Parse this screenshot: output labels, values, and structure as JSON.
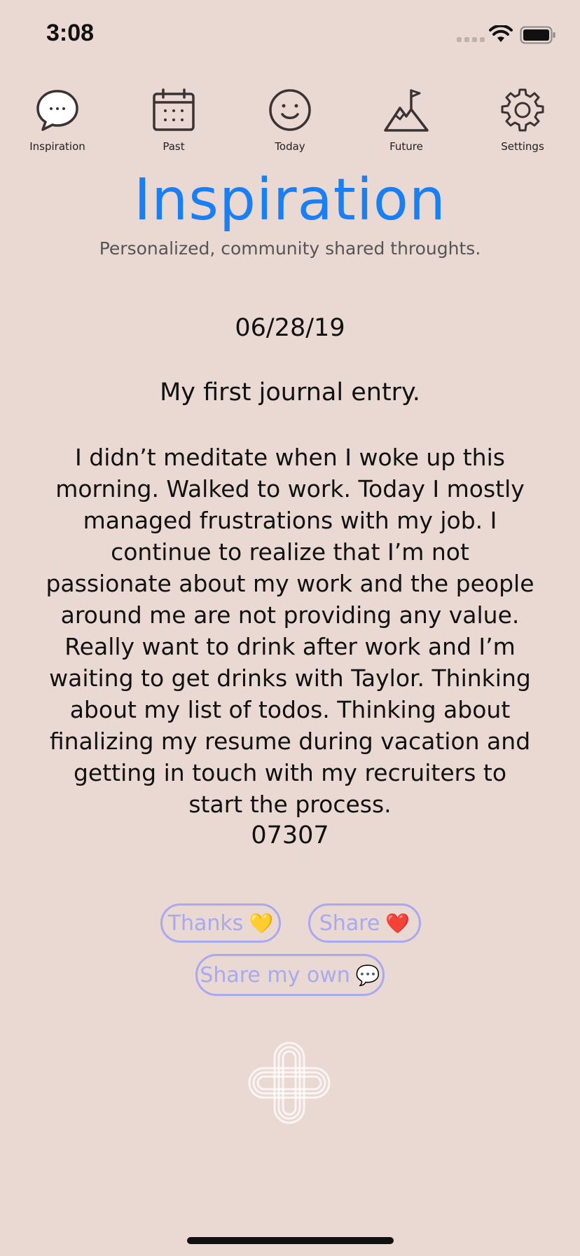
{
  "status": {
    "time": "3:08"
  },
  "nav": {
    "items": [
      {
        "label": "Inspiration",
        "icon": "speech-bubble-icon"
      },
      {
        "label": "Past",
        "icon": "calendar-icon"
      },
      {
        "label": "Today",
        "icon": "smiley-icon"
      },
      {
        "label": "Future",
        "icon": "mountain-flag-icon"
      },
      {
        "label": "Settings",
        "icon": "gear-icon"
      }
    ]
  },
  "header": {
    "title": "Inspiration",
    "subtitle": "Personalized, community shared throughts."
  },
  "entry": {
    "date": "06/28/19",
    "title": "My first journal entry.",
    "body": "I didn’t meditate when I woke up this morning.  Walked to work.  Today I mostly managed frustrations with my job.  I continue to realize that I’m not passionate about my work and the people around me are not providing any value.  Really want to drink after work and I’m waiting to get drinks with Taylor.  Thinking about my list of todos.  Thinking about finalizing my resume during vacation and getting in touch with my recruiters to start the process.",
    "code": "07307"
  },
  "actions": {
    "thanks_label": "Thanks",
    "thanks_emoji": "💛",
    "share_label": "Share",
    "share_emoji": "❤️",
    "share_own_label": "Share my own",
    "share_own_emoji": "💬"
  },
  "colors": {
    "background": "#ead8d3",
    "accent": "#1a7ff5",
    "pill": "#a9a9ee"
  }
}
